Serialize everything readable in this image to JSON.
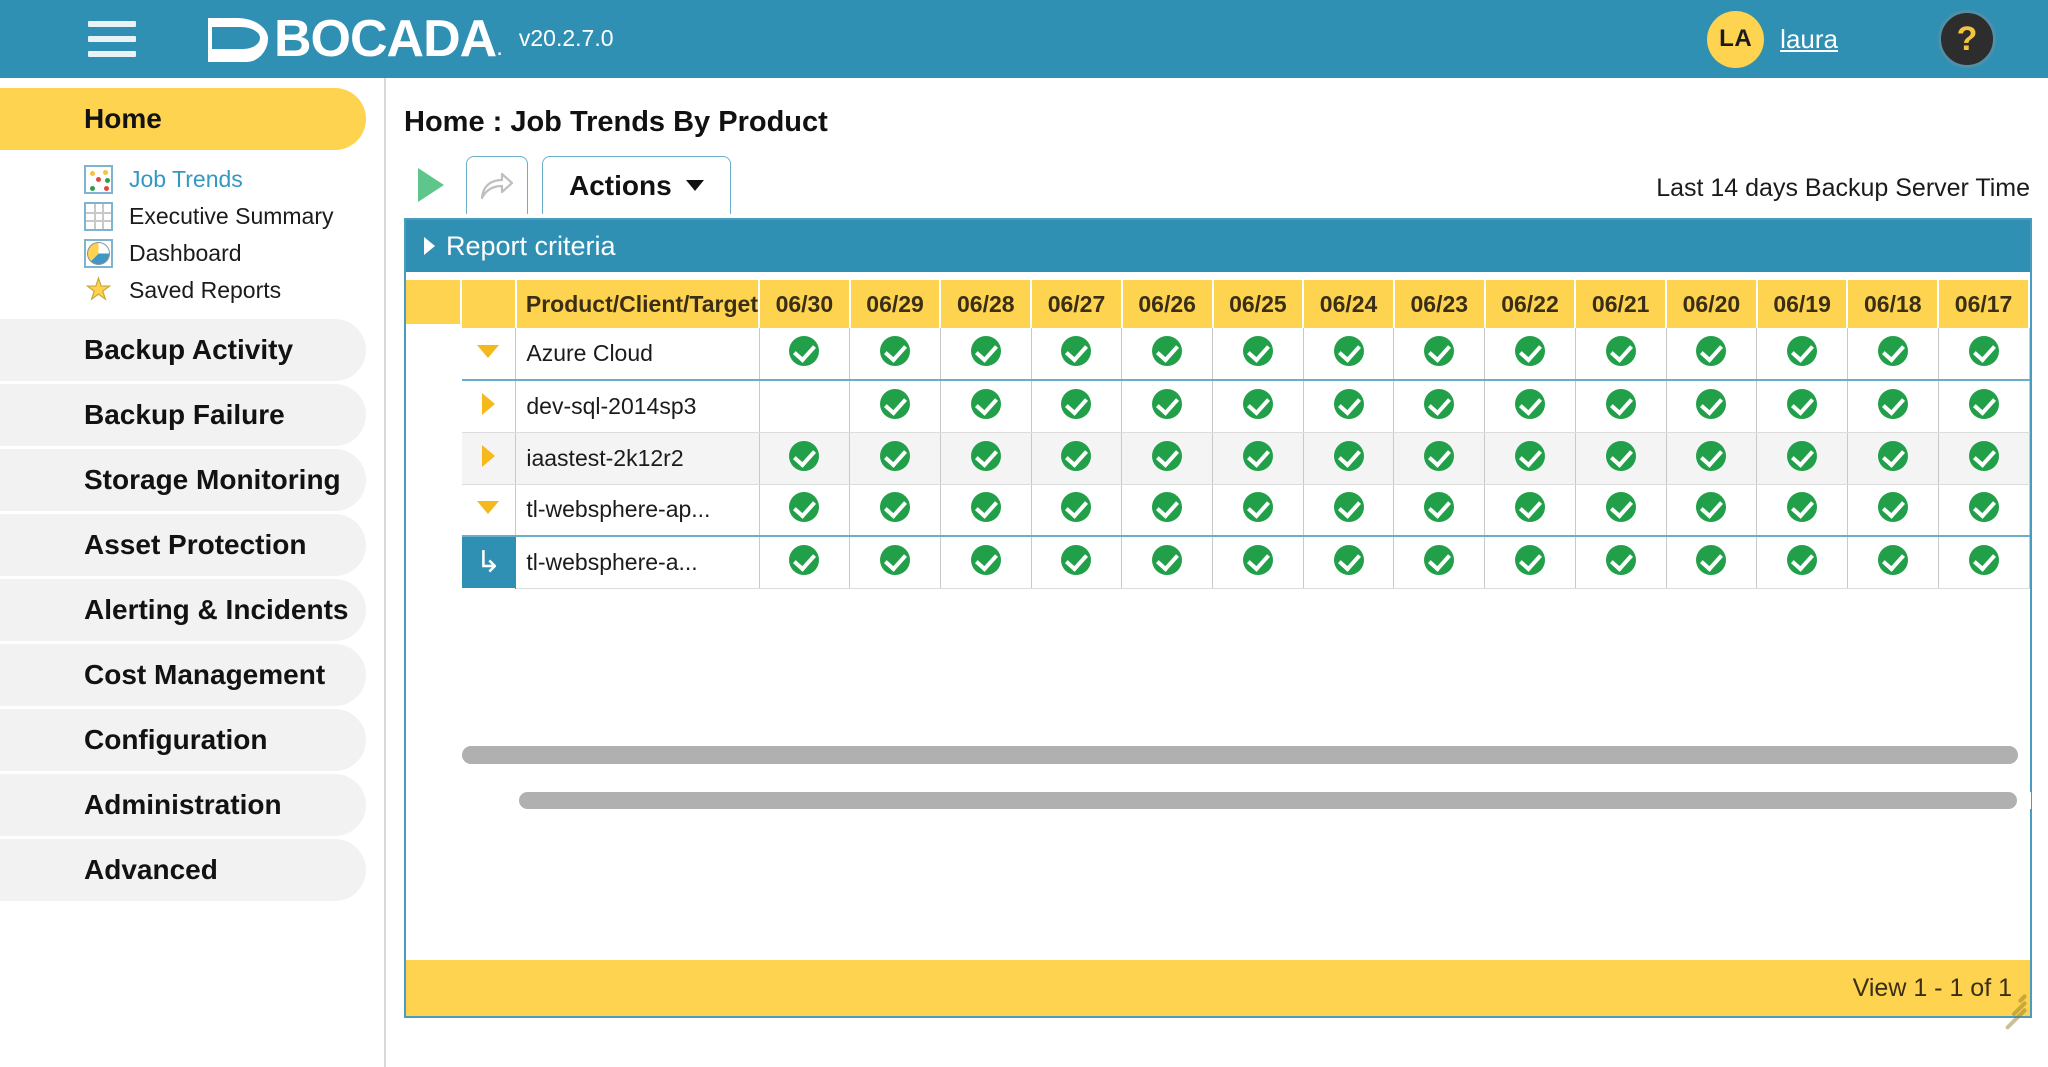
{
  "header": {
    "menu_icon": "hamburger-icon",
    "logo_text": "BOCADA",
    "logo_dot": ".",
    "version": "v20.2.7.0",
    "avatar_initials": "LA",
    "username": "laura",
    "help_label": "?"
  },
  "sidebar": {
    "groups": [
      {
        "label": "Home",
        "active": true
      },
      {
        "label": "Backup Activity",
        "active": false
      },
      {
        "label": "Backup Failure",
        "active": false
      },
      {
        "label": "Storage Monitoring",
        "active": false
      },
      {
        "label": "Asset Protection",
        "active": false
      },
      {
        "label": "Alerting & Incidents",
        "active": false
      },
      {
        "label": "Cost Management",
        "active": false
      },
      {
        "label": "Configuration",
        "active": false
      },
      {
        "label": "Administration",
        "active": false
      },
      {
        "label": "Advanced",
        "active": false
      }
    ],
    "home_items": [
      {
        "label": "Job Trends",
        "icon": "scatter-plot-icon",
        "selected": true
      },
      {
        "label": "Executive Summary",
        "icon": "table-grid-icon",
        "selected": false
      },
      {
        "label": "Dashboard",
        "icon": "pie-chart-icon",
        "selected": false
      },
      {
        "label": "Saved Reports",
        "icon": "star-icon",
        "selected": false
      }
    ]
  },
  "main": {
    "breadcrumb": "Home : Job Trends By Product",
    "toolbar": {
      "run_icon": "play-icon",
      "share_icon": "share-arrow-icon",
      "actions_label": "Actions",
      "time_range": "Last 14 days Backup Server Time"
    },
    "criteria": {
      "label": "Report criteria",
      "expanded": false
    },
    "footer": {
      "view_text": "View 1 - 1 of 1"
    }
  },
  "grid": {
    "name_column_header": "Product/Client/Target",
    "date_columns": [
      "06/30",
      "06/29",
      "06/28",
      "06/27",
      "06/26",
      "06/25",
      "06/24",
      "06/23",
      "06/22",
      "06/21",
      "06/20",
      "06/19",
      "06/18",
      "06/17"
    ],
    "rows": [
      {
        "name": "Azure Cloud",
        "level": 0,
        "toggle": "chevron-down-icon",
        "expanded": true,
        "alt": false,
        "status": [
          "ok",
          "ok",
          "ok",
          "ok",
          "ok",
          "ok",
          "ok",
          "ok",
          "ok",
          "ok",
          "ok",
          "ok",
          "ok",
          "ok"
        ]
      },
      {
        "name": "dev-sql-2014sp3",
        "level": 1,
        "toggle": "chevron-right-icon",
        "expanded": false,
        "alt": false,
        "status": [
          "none",
          "ok",
          "ok",
          "ok",
          "ok",
          "ok",
          "ok",
          "ok",
          "ok",
          "ok",
          "ok",
          "ok",
          "ok",
          "ok"
        ]
      },
      {
        "name": "iaastest-2k12r2",
        "level": 1,
        "toggle": "chevron-right-icon",
        "expanded": false,
        "alt": true,
        "status": [
          "ok",
          "ok",
          "ok",
          "ok",
          "ok",
          "ok",
          "ok",
          "ok",
          "ok",
          "ok",
          "ok",
          "ok",
          "ok",
          "ok"
        ]
      },
      {
        "name": "tl-websphere-ap...",
        "level": 1,
        "toggle": "chevron-down-icon",
        "expanded": true,
        "alt": false,
        "status": [
          "ok",
          "ok",
          "ok",
          "ok",
          "ok",
          "ok",
          "ok",
          "ok",
          "ok",
          "ok",
          "ok",
          "ok",
          "ok",
          "ok"
        ]
      },
      {
        "name": "tl-websphere-a...",
        "level": 2,
        "toggle": "",
        "expanded": false,
        "alt": false,
        "status": [
          "ok",
          "ok",
          "ok",
          "ok",
          "ok",
          "ok",
          "ok",
          "ok",
          "ok",
          "ok",
          "ok",
          "ok",
          "ok",
          "ok"
        ]
      }
    ]
  },
  "colors": {
    "brand_teal": "#2f90b4",
    "accent_yellow": "#fdd34f",
    "status_ok_green": "#21a049",
    "chevron_yellow": "#f5b81d"
  }
}
